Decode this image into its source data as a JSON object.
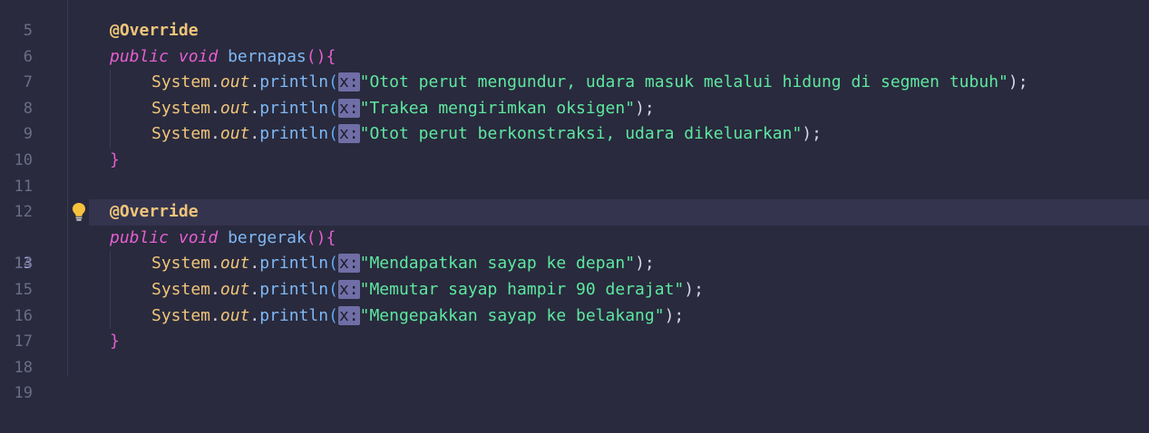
{
  "editor": {
    "current_line": "13",
    "lines": [
      {
        "no": "5"
      },
      {
        "no": "6",
        "annotation": "@Override"
      },
      {
        "no": "7",
        "kw1": "public",
        "kw2": "void",
        "method": "bernapas",
        "open": "(){"
      },
      {
        "no": "8",
        "cls": "System",
        "field": "out",
        "call": "println",
        "hint": "x:",
        "str": "\"Otot perut mengundur, udara masuk melalui hidung di segmen tubuh\"",
        "end": ");"
      },
      {
        "no": "9",
        "cls": "System",
        "field": "out",
        "call": "println",
        "hint": "x:",
        "str": "\"Trakea mengirimkan oksigen\"",
        "end": ");"
      },
      {
        "no": "10",
        "cls": "System",
        "field": "out",
        "call": "println",
        "hint": "x:",
        "str": "\"Otot perut berkonstraksi, udara dikeluarkan\"",
        "end": ");"
      },
      {
        "no": "11",
        "brace": "}"
      },
      {
        "no": "12"
      },
      {
        "no": "13",
        "annotation": "@Override"
      },
      {
        "no": "14",
        "kw1": "public",
        "kw2": "void",
        "method": "bergerak",
        "open": "(){"
      },
      {
        "no": "15",
        "cls": "System",
        "field": "out",
        "call": "println",
        "hint": "x:",
        "str": "\"Mendapatkan sayap ke depan\"",
        "end": ");"
      },
      {
        "no": "16",
        "cls": "System",
        "field": "out",
        "call": "println",
        "hint": "x:",
        "str": "\"Memutar sayap hampir 90 derajat\"",
        "end": ");"
      },
      {
        "no": "17",
        "cls": "System",
        "field": "out",
        "call": "println",
        "hint": "x:",
        "str": "\"Mengepakkan sayap ke belakang\"",
        "end": ");"
      },
      {
        "no": "18",
        "brace": "}"
      },
      {
        "no": "19"
      }
    ],
    "gutter_icon": "lightbulb-icon"
  }
}
